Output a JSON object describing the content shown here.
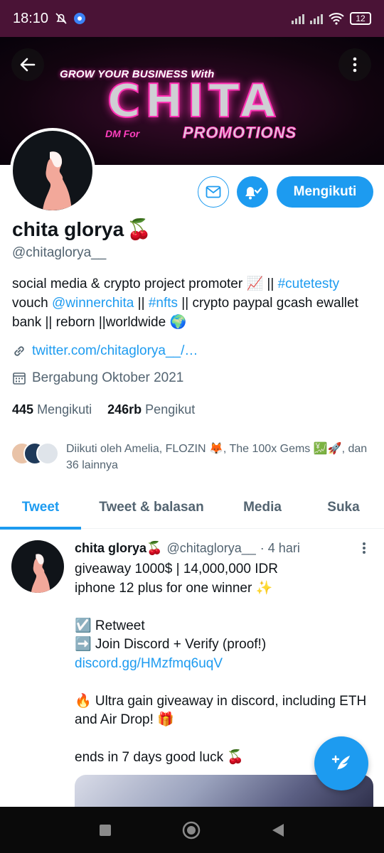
{
  "status_bar": {
    "time": "18:10",
    "battery": "12"
  },
  "banner": {
    "line1": "GROW YOUR BUSINESS With",
    "brand": "CHITA",
    "dm": "DM For",
    "promo": "PROMOTIONS",
    "accent": "#ff2fb3"
  },
  "actions": {
    "follow_label": "Mengikuti"
  },
  "profile": {
    "name": "chita glorya",
    "name_emoji": "🍒",
    "handle": "@chitaglorya__",
    "bio_1": "social media & crypto project promoter 📈 || ",
    "bio_tag1": "#cutetesty",
    "bio_2": "vouch ",
    "bio_mention": "@winnerchita",
    "bio_3": " || ",
    "bio_tag2": "#nfts",
    "bio_4": " || crypto paypal gcash ewallet bank || reborn ||worldwide 🌍",
    "website": "twitter.com/chitaglorya__/…",
    "joined": "Bergabung Oktober 2021",
    "following_count": "445",
    "following_label": "Mengikuti",
    "followers_count": "246rb",
    "followers_label": "Pengikut",
    "followed_by": "Diikuti oleh Amelia, FLOZIN 🦊, The 100x Gems 💹🚀, dan 36 lainnya"
  },
  "tabs": [
    "Tweet",
    "Tweet & balasan",
    "Media",
    "Suka"
  ],
  "tweet": {
    "name": "chita glorya🍒",
    "handle": "@chitaglorya__",
    "time": "· 4 hari",
    "lines": [
      "giveaway 1000$ | 14,000,000 IDR",
      "iphone 12 plus for one winner ✨",
      "",
      "☑️ Retweet",
      "➡️ Join Discord + Verify (proof!)"
    ],
    "link": "discord.gg/HMzfmq6uqV",
    "lines2": [
      "",
      "🔥 Ultra gain giveaway in discord, including ETH and Air Drop! 🎁",
      "",
      "ends in 7 days good luck 🍒"
    ]
  },
  "colors": {
    "primary": "#1d9bf0",
    "status_bar": "#4a1336"
  },
  "icons": [
    "back-arrow-icon",
    "more-vertical-icon",
    "mail-icon",
    "bell-check-icon",
    "link-icon",
    "calendar-icon",
    "compose-icon"
  ]
}
